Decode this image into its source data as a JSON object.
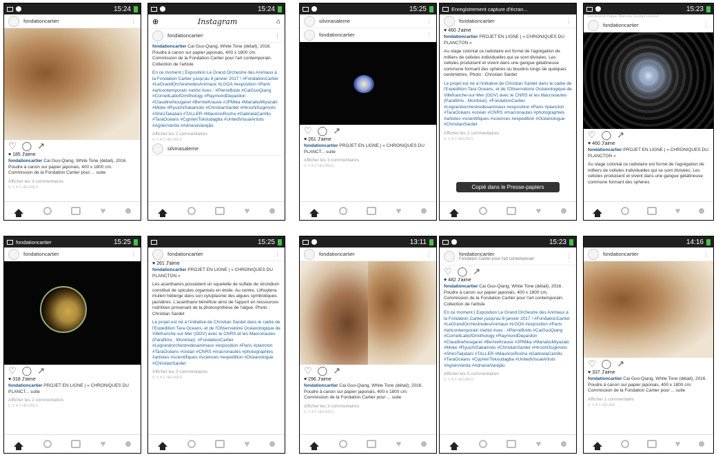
{
  "frames": [
    {
      "time": "15:24",
      "user": "fondationcartier",
      "likes": "185 J'aime",
      "caption_user": "fondationcartier",
      "caption": "Cai Guo-Qiang, White Tone (détail), 2016. Poudre à canon sur papier japonais, 400 x 1800 cm. Commission de la Fondation Cartier pour ... suite",
      "comments": "Afficher les 3 commentaires",
      "date": "IL Y A 2 HEURES"
    },
    {
      "time": "15:24",
      "app_title": "Instagram",
      "user": "fondationcartier",
      "caption_user": "fondationcartier",
      "caption": "Cai Guo-Qiang, White Tone (détail), 2016. Poudre à canon sur papier japonais, 400 x 1800 cm. Commission de la Fondation Cartier pour l'art contemporain. Collection de l'artiste",
      "caption2": "En ce moment | Exposition Le Grand Orchestre des Animaux à la Fondation Cartier jusqu'au 8 janvier 2017 ! #FondationCartier #LeGrandOrchestredesAnimaux #LGOA #exposition #Paris #artcontemporain #artist Avec : #PierreBodo #CaiGuoQiang #CornellLabofOrnithology #RaymondDepardon #ClaudineNougaret #BernieKrause #JPMika #ManabuMiyazaki #Moke #RyuichiSakamoto #ChristianSardet #HiroshiSugimoto #ShiroTakatani #TALLER #MauricioRocha #GabrielaCarrillo #TaraOcéans #CyprienTokoudagba #UnitedVisualArtists #AgnèsVarda #AdrianaVarejão",
      "comments": "Afficher les 2 commentaires",
      "date": "IL Y A 2 HEURES",
      "next_user": "silvinasaleme"
    },
    {
      "time": "15:25",
      "top_user": "silvinasaleme",
      "user": "fondationcartier",
      "likes": "261 J'aime",
      "caption_user": "fondationcartier",
      "caption": "PROJET EN LIGNE | « CHRONIQUES DU PLANCT... suite",
      "comments": "Afficher les 3 commentaires",
      "date": "IL Y A 2 HEURES"
    },
    {
      "time": "",
      "notif": "Enregistrement capture d'écran...",
      "user": "fondationcartier",
      "likes": "460 J'aime",
      "caption_user": "fondationcartier",
      "caption": "PROJET EN LIGNE | « CHRONIQUES DU PLANCTON »",
      "caption2": "Au stage colonial ce radiolaire est formé de l'agrégation de milliers de cellules individuelles qui se sont divisées. Les cellules produisent et vivent dans une gangue gélatineuse commune formant des sphères ou boudins longs de quelques centimètres. Photo : Christian Sardet",
      "caption3": "Le projet est né à l'initiative de Christian Sardet dans le cadre de l'Expédition Tara Oceans, et de l'Observatoire Océanologique de Villefranche-sur-Mer (OOV) avec le CNRS et les Macronautes (Parafilms , Montréal). #FondationCartier #Legrandorchestredesanimaux #exposition #Paris #plancton #TaraOcéans #océan #CNRS #macronautes #photographies #artistes #scientifiques #sciences #expedition #Océanologue #ChristianSardet",
      "comments": "Afficher les 2 commentaires",
      "date": "IL Y A 2 HEURES",
      "toast": "Copié dans le Presse-papiers"
    },
    {
      "time": "15:23",
      "top_user": "fondationcartier",
      "top_sub": "Recyclerie Papas Blancas Cordas Léoutel",
      "user": "fondationcartier",
      "likes": "460 J'aime",
      "caption_user": "fondationcartier",
      "caption": "PROJET EN LIGNE | « CHRONIQUES DU PLANCTON »",
      "caption2": "Au stage colonial ce radiolaire est formé de l'agrégation de milliers de cellules individuelles qui se sont divisées. Les cellules produisent et vivent dans une gangue gélatineuse commune formant des sphères"
    },
    {
      "time": "15:25",
      "top_user": "fondationcartier",
      "user": "fondationcartier",
      "likes": "318 J'aime",
      "caption_user": "fondationcartier",
      "caption": "PROJET EN LIGNE | « CHRONIQUES DU PLANCT... suite",
      "comments": "Afficher les 2 commentaires",
      "date": "IL Y A 2 HEURES"
    },
    {
      "time": "15:25",
      "user": "fondationcartier",
      "likes": "261 J'aime",
      "caption_user": "fondationcartier",
      "caption": "PROJET EN LIGNE | « CHRONIQUES DU PLANCTON »",
      "caption2": "Les acanthaires possèdent un squelette de sulfate de strondium constitué de spicules organisés en étoile. Au centre, Lithoptera mulleri héberge dans son cytoplasme des algues symbiotiques jaunâtres. L'acanthaire bénéficie ainsi de l'apport en ressources nutritives provenant de la photosynthèse de l'algue. Photo : Christian Sardet",
      "caption3": "Le projet est né à l'initiative de Christian Sardet dans le cadre de l'Expédition Tara Oceans, et de l'Observatoire Océanologique de Villefranche-sur-Mer (OOV) avec le CNRS et les Macronautes (Parafilms , Montréal). #FondationCartier #Legrandorchestredesanimaux #exposition #Paris #plancton #TaraOcéans #océan #CNRS #macronautes #photographies #artistes #scientifiques #sciences #expedition #Océanologue #ChristianSardet",
      "comments": "Afficher les 3 commentaires",
      "date": "IL Y A 2 HEURES"
    },
    {
      "time": "13:11",
      "user": "fondationcartier",
      "likes": "296 J'aime",
      "caption_user": "fondationcartier",
      "caption": "Cai Guo-Qiang, White Tone (détail), 2016. Poudre à canon sur papier japonais, 400 x 1800 cm. Commission de la Fondation Cartier pour ... suite",
      "comments": "Afficher les 3 commentaires",
      "date": "IL Y A 2 HEURES"
    },
    {
      "time": "15:23",
      "user": "fondationcartier",
      "user_sub": "Fondation Cartier pour l'art contemporain",
      "likes": "482 J'aime",
      "caption_user": "fondationcartier",
      "caption": "Cai Guo-Qiang, White Tone (détail), 2016. Poudre à canon sur papier japonais, 400 x 1800 cm. Commission de la Fondation Cartier pour l'art contemporain. Collection de l'artiste",
      "caption2": "En ce moment | Exposition Le Grand Orchestre des Animaux à la Fondation Cartier jusqu'au 8 janvier 2017 ! #FondationCartier #LeGrandOrchestredesAnimaux #LGOA #exposition #Paris #artcontemporain #artist Avec : #PierreBodo #CaiGuoQiang #CornellLabofOrnithology #RaymondDepardon #ClaudineNougaret #BernieKrause #JPMika #ManabuMiyazaki #Moke #RyuichiSakamoto #ChristianSardet #HiroshiSugimoto #ShiroTakatani #TALLER #MauricioRocha #GabrielaCarrillo #TaraOcéans #CyprienTokoudagba #UnitedVisualArtists #AgnèsVarda #AdrianaVarejão",
      "comments": "Afficher les 5 commentaires",
      "date": "IL Y A 2 HEURES"
    },
    {
      "time": "14:16",
      "user": "fondationcartier",
      "likes": "337 J'aime",
      "caption_user": "fondationcartier",
      "caption": "Cai Guo-Qiang, White Tone (détail), 2016. Poudre à canon sur papier japonais, 400 x 1800 cm. Commission de la Fondation Cartier pour ... suite",
      "comments": "Afficher 1 commentaire",
      "date": "IL Y A 1 HEURE"
    }
  ]
}
